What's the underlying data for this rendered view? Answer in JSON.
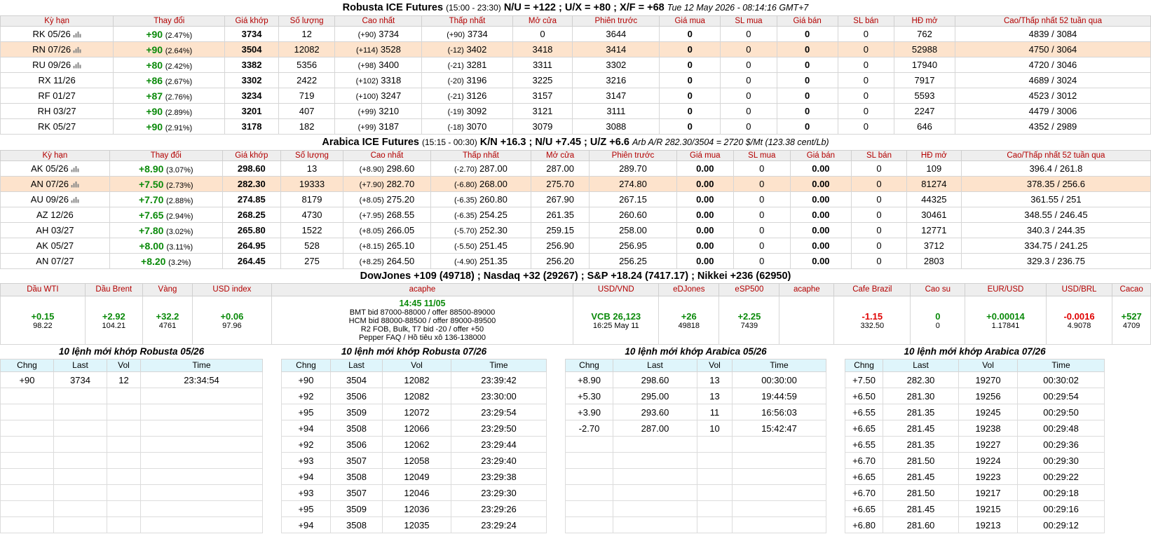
{
  "robusta": {
    "title_main": "Robusta ICE Futures",
    "title_hours": "(15:00 - 23:30)",
    "title_spreads": "N/U = +122 ; U/X = +80 ; X/F = +68",
    "title_time": "Tue 12 May 2026 - 08:14:16 GMT+7",
    "headers": [
      "Kỳ hạn",
      "Thay đổi",
      "Giá khớp",
      "Số lượng",
      "Cao nhất",
      "Thấp nhất",
      "Mở cửa",
      "Phiên trước",
      "Giá mua",
      "SL mua",
      "Giá bán",
      "SL bán",
      "HĐ mở",
      "Cao/Thấp nhất 52 tuần qua"
    ],
    "rows": [
      {
        "term": "RK 05/26",
        "chart": true,
        "chg": "+90",
        "pct": "(2.47%)",
        "last": "3734",
        "vol": "12",
        "high_chg": "(+90)",
        "high": "3734",
        "low_chg": "(+90)",
        "low": "3734",
        "open": "0",
        "prev": "3644",
        "bid": "0",
        "bid_qty": "0",
        "ask": "0",
        "ask_qty": "0",
        "oi": "762",
        "w52": "4839 / 3084",
        "hl": false
      },
      {
        "term": "RN 07/26",
        "chart": true,
        "chg": "+90",
        "pct": "(2.64%)",
        "last": "3504",
        "vol": "12082",
        "high_chg": "(+114)",
        "high": "3528",
        "low_chg": "(-12)",
        "low": "3402",
        "open": "3418",
        "prev": "3414",
        "bid": "0",
        "bid_qty": "0",
        "ask": "0",
        "ask_qty": "0",
        "oi": "52988",
        "w52": "4750 / 3064",
        "hl": true
      },
      {
        "term": "RU 09/26",
        "chart": true,
        "chg": "+80",
        "pct": "(2.42%)",
        "last": "3382",
        "vol": "5356",
        "high_chg": "(+98)",
        "high": "3400",
        "low_chg": "(-21)",
        "low": "3281",
        "open": "3311",
        "prev": "3302",
        "bid": "0",
        "bid_qty": "0",
        "ask": "0",
        "ask_qty": "0",
        "oi": "17940",
        "w52": "4720 / 3046",
        "hl": false
      },
      {
        "term": "RX 11/26",
        "chart": false,
        "chg": "+86",
        "pct": "(2.67%)",
        "last": "3302",
        "vol": "2422",
        "high_chg": "(+102)",
        "high": "3318",
        "low_chg": "(-20)",
        "low": "3196",
        "open": "3225",
        "prev": "3216",
        "bid": "0",
        "bid_qty": "0",
        "ask": "0",
        "ask_qty": "0",
        "oi": "7917",
        "w52": "4689 / 3024",
        "hl": false
      },
      {
        "term": "RF 01/27",
        "chart": false,
        "chg": "+87",
        "pct": "(2.76%)",
        "last": "3234",
        "vol": "719",
        "high_chg": "(+100)",
        "high": "3247",
        "low_chg": "(-21)",
        "low": "3126",
        "open": "3157",
        "prev": "3147",
        "bid": "0",
        "bid_qty": "0",
        "ask": "0",
        "ask_qty": "0",
        "oi": "5593",
        "w52": "4523 / 3012",
        "hl": false
      },
      {
        "term": "RH 03/27",
        "chart": false,
        "chg": "+90",
        "pct": "(2.89%)",
        "last": "3201",
        "vol": "407",
        "high_chg": "(+99)",
        "high": "3210",
        "low_chg": "(-19)",
        "low": "3092",
        "open": "3121",
        "prev": "3111",
        "bid": "0",
        "bid_qty": "0",
        "ask": "0",
        "ask_qty": "0",
        "oi": "2247",
        "w52": "4479 / 3006",
        "hl": false
      },
      {
        "term": "RK 05/27",
        "chart": false,
        "chg": "+90",
        "pct": "(2.91%)",
        "last": "3178",
        "vol": "182",
        "high_chg": "(+99)",
        "high": "3187",
        "low_chg": "(-18)",
        "low": "3070",
        "open": "3079",
        "prev": "3088",
        "bid": "0",
        "bid_qty": "0",
        "ask": "0",
        "ask_qty": "0",
        "oi": "646",
        "w52": "4352 / 2989",
        "hl": false
      }
    ]
  },
  "arabica": {
    "title_main": "Arabica ICE Futures",
    "title_hours": "(15:15 - 00:30)",
    "title_spreads": "K/N +16.3 ; N/U +7.45 ; U/Z +6.6",
    "title_arb": "Arb A/R 282.30/3504 = 2720 $/Mt (123.38 cent/Lb)",
    "headers": [
      "Kỳ hạn",
      "Thay đổi",
      "Giá khớp",
      "Số lượng",
      "Cao nhất",
      "Thấp nhất",
      "Mở cửa",
      "Phiên trước",
      "Giá mua",
      "SL mua",
      "Giá bán",
      "SL bán",
      "HĐ mở",
      "Cao/Thấp nhất 52 tuần qua"
    ],
    "rows": [
      {
        "term": "AK 05/26",
        "chart": true,
        "chg": "+8.90",
        "pct": "(3.07%)",
        "last": "298.60",
        "vol": "13",
        "high_chg": "(+8.90)",
        "high": "298.60",
        "low_chg": "(-2.70)",
        "low": "287.00",
        "open": "287.00",
        "prev": "289.70",
        "bid": "0.00",
        "bid_qty": "0",
        "ask": "0.00",
        "ask_qty": "0",
        "oi": "109",
        "w52": "396.4 / 261.8",
        "hl": false
      },
      {
        "term": "AN 07/26",
        "chart": true,
        "chg": "+7.50",
        "pct": "(2.73%)",
        "last": "282.30",
        "vol": "19333",
        "high_chg": "(+7.90)",
        "high": "282.70",
        "low_chg": "(-6.80)",
        "low": "268.00",
        "open": "275.70",
        "prev": "274.80",
        "bid": "0.00",
        "bid_qty": "0",
        "ask": "0.00",
        "ask_qty": "0",
        "oi": "81274",
        "w52": "378.35 / 256.6",
        "hl": true
      },
      {
        "term": "AU 09/26",
        "chart": true,
        "chg": "+7.70",
        "pct": "(2.88%)",
        "last": "274.85",
        "vol": "8179",
        "high_chg": "(+8.05)",
        "high": "275.20",
        "low_chg": "(-6.35)",
        "low": "260.80",
        "open": "267.90",
        "prev": "267.15",
        "bid": "0.00",
        "bid_qty": "0",
        "ask": "0.00",
        "ask_qty": "0",
        "oi": "44325",
        "w52": "361.55 / 251",
        "hl": false
      },
      {
        "term": "AZ 12/26",
        "chart": false,
        "chg": "+7.65",
        "pct": "(2.94%)",
        "last": "268.25",
        "vol": "4730",
        "high_chg": "(+7.95)",
        "high": "268.55",
        "low_chg": "(-6.35)",
        "low": "254.25",
        "open": "261.35",
        "prev": "260.60",
        "bid": "0.00",
        "bid_qty": "0",
        "ask": "0.00",
        "ask_qty": "0",
        "oi": "30461",
        "w52": "348.55 / 246.45",
        "hl": false
      },
      {
        "term": "AH 03/27",
        "chart": false,
        "chg": "+7.80",
        "pct": "(3.02%)",
        "last": "265.80",
        "vol": "1522",
        "high_chg": "(+8.05)",
        "high": "266.05",
        "low_chg": "(-5.70)",
        "low": "252.30",
        "open": "259.15",
        "prev": "258.00",
        "bid": "0.00",
        "bid_qty": "0",
        "ask": "0.00",
        "ask_qty": "0",
        "oi": "12771",
        "w52": "340.3 / 244.35",
        "hl": false
      },
      {
        "term": "AK 05/27",
        "chart": false,
        "chg": "+8.00",
        "pct": "(3.11%)",
        "last": "264.95",
        "vol": "528",
        "high_chg": "(+8.15)",
        "high": "265.10",
        "low_chg": "(-5.50)",
        "low": "251.45",
        "open": "256.90",
        "prev": "256.95",
        "bid": "0.00",
        "bid_qty": "0",
        "ask": "0.00",
        "ask_qty": "0",
        "oi": "3712",
        "w52": "334.75 / 241.25",
        "hl": false
      },
      {
        "term": "AN 07/27",
        "chart": false,
        "chg": "+8.20",
        "pct": "(3.2%)",
        "last": "264.45",
        "vol": "275",
        "high_chg": "(+8.25)",
        "high": "264.50",
        "low_chg": "(-4.90)",
        "low": "251.35",
        "open": "256.20",
        "prev": "256.25",
        "bid": "0.00",
        "bid_qty": "0",
        "ask": "0.00",
        "ask_qty": "0",
        "oi": "2803",
        "w52": "329.3 / 236.75",
        "hl": false
      }
    ]
  },
  "indices_title": "DowJones +109 (49718) ; Nasdaq +32 (29267) ; S&P +18.24 (7417.17) ; Nikkei +236 (62950)",
  "markets": {
    "h_wti": "Dầu WTI",
    "wti_chg": "+0.15",
    "wti_price": "98.22",
    "h_brent": "Dầu Brent",
    "brent_chg": "+2.92",
    "brent_price": "104.21",
    "h_gold": "Vàng",
    "gold_chg": "+32.2",
    "gold_price": "4761",
    "h_usdx": "USD index",
    "usdx_chg": "+0.06",
    "usdx_price": "97.96",
    "h_acaphe1": "acaphe",
    "acaphe_time": "14:45 11/05",
    "acaphe_l1": "BMT bid 87000-88000 / offer 88500-89000",
    "acaphe_l2": "HCM bid 88000-88500 / offer 89000-89500",
    "acaphe_l3": "R2 FOB, Bulk, T7 bid -20 / offer +50",
    "acaphe_l4": "Pepper FAQ / Hồ tiêu xô 136-138000",
    "h_usdvnd": "USD/VND",
    "usdvnd_val": "VCB 26,123",
    "usdvnd_time": "16:25 May 11",
    "h_edjones": "eDJones",
    "edjones_chg": "+26",
    "edjones_price": "49818",
    "h_esp500": "eSP500",
    "esp500_chg": "+2.25",
    "esp500_price": "7439",
    "h_acaphe2": "acaphe",
    "h_cafebrazil": "Cafe Brazil",
    "cafebrazil_chg": "-1.15",
    "cafebrazil_price": "332.50",
    "h_caosu": "Cao su",
    "caosu_chg": "0",
    "caosu_price": "0",
    "h_eurusd": "EUR/USD",
    "eurusd_chg": "+0.00014",
    "eurusd_price": "1.17841",
    "h_usdbrl": "USD/BRL",
    "usdbrl_chg": "-0.0016",
    "usdbrl_price": "4.9078",
    "h_cacao": "Cacao",
    "cacao_chg": "+527",
    "cacao_price": "4709"
  },
  "trade_headers": [
    "Chng",
    "Last",
    "Vol",
    "Time"
  ],
  "trades": [
    {
      "title": "10 lệnh mới khớp Robusta 05/26",
      "rows": [
        [
          "+90",
          "3734",
          "12",
          "23:34:54"
        ]
      ]
    },
    {
      "title": "10 lệnh mới khớp Robusta 07/26",
      "rows": [
        [
          "+90",
          "3504",
          "12082",
          "23:39:42"
        ],
        [
          "+92",
          "3506",
          "12082",
          "23:30:00"
        ],
        [
          "+95",
          "3509",
          "12072",
          "23:29:54"
        ],
        [
          "+94",
          "3508",
          "12066",
          "23:29:50"
        ],
        [
          "+92",
          "3506",
          "12062",
          "23:29:44"
        ],
        [
          "+93",
          "3507",
          "12058",
          "23:29:40"
        ],
        [
          "+94",
          "3508",
          "12049",
          "23:29:38"
        ],
        [
          "+93",
          "3507",
          "12046",
          "23:29:30"
        ],
        [
          "+95",
          "3509",
          "12036",
          "23:29:26"
        ],
        [
          "+94",
          "3508",
          "12035",
          "23:29:24"
        ]
      ]
    },
    {
      "title": "10 lệnh mới khớp Arabica 05/26",
      "rows": [
        [
          "+8.90",
          "298.60",
          "13",
          "00:30:00"
        ],
        [
          "+5.30",
          "295.00",
          "13",
          "19:44:59"
        ],
        [
          "+3.90",
          "293.60",
          "11",
          "16:56:03"
        ],
        [
          "-2.70",
          "287.00",
          "10",
          "15:42:47"
        ]
      ]
    },
    {
      "title": "10 lệnh mới khớp Arabica 07/26",
      "rows": [
        [
          "+7.50",
          "282.30",
          "19270",
          "00:30:02"
        ],
        [
          "+6.50",
          "281.30",
          "19256",
          "00:29:54"
        ],
        [
          "+6.55",
          "281.35",
          "19245",
          "00:29:50"
        ],
        [
          "+6.65",
          "281.45",
          "19238",
          "00:29:48"
        ],
        [
          "+6.55",
          "281.35",
          "19227",
          "00:29:36"
        ],
        [
          "+6.70",
          "281.50",
          "19224",
          "00:29:30"
        ],
        [
          "+6.65",
          "281.45",
          "19223",
          "00:29:22"
        ],
        [
          "+6.70",
          "281.50",
          "19217",
          "00:29:18"
        ],
        [
          "+6.65",
          "281.45",
          "19215",
          "00:29:16"
        ],
        [
          "+6.80",
          "281.60",
          "19213",
          "00:29:12"
        ]
      ]
    }
  ]
}
